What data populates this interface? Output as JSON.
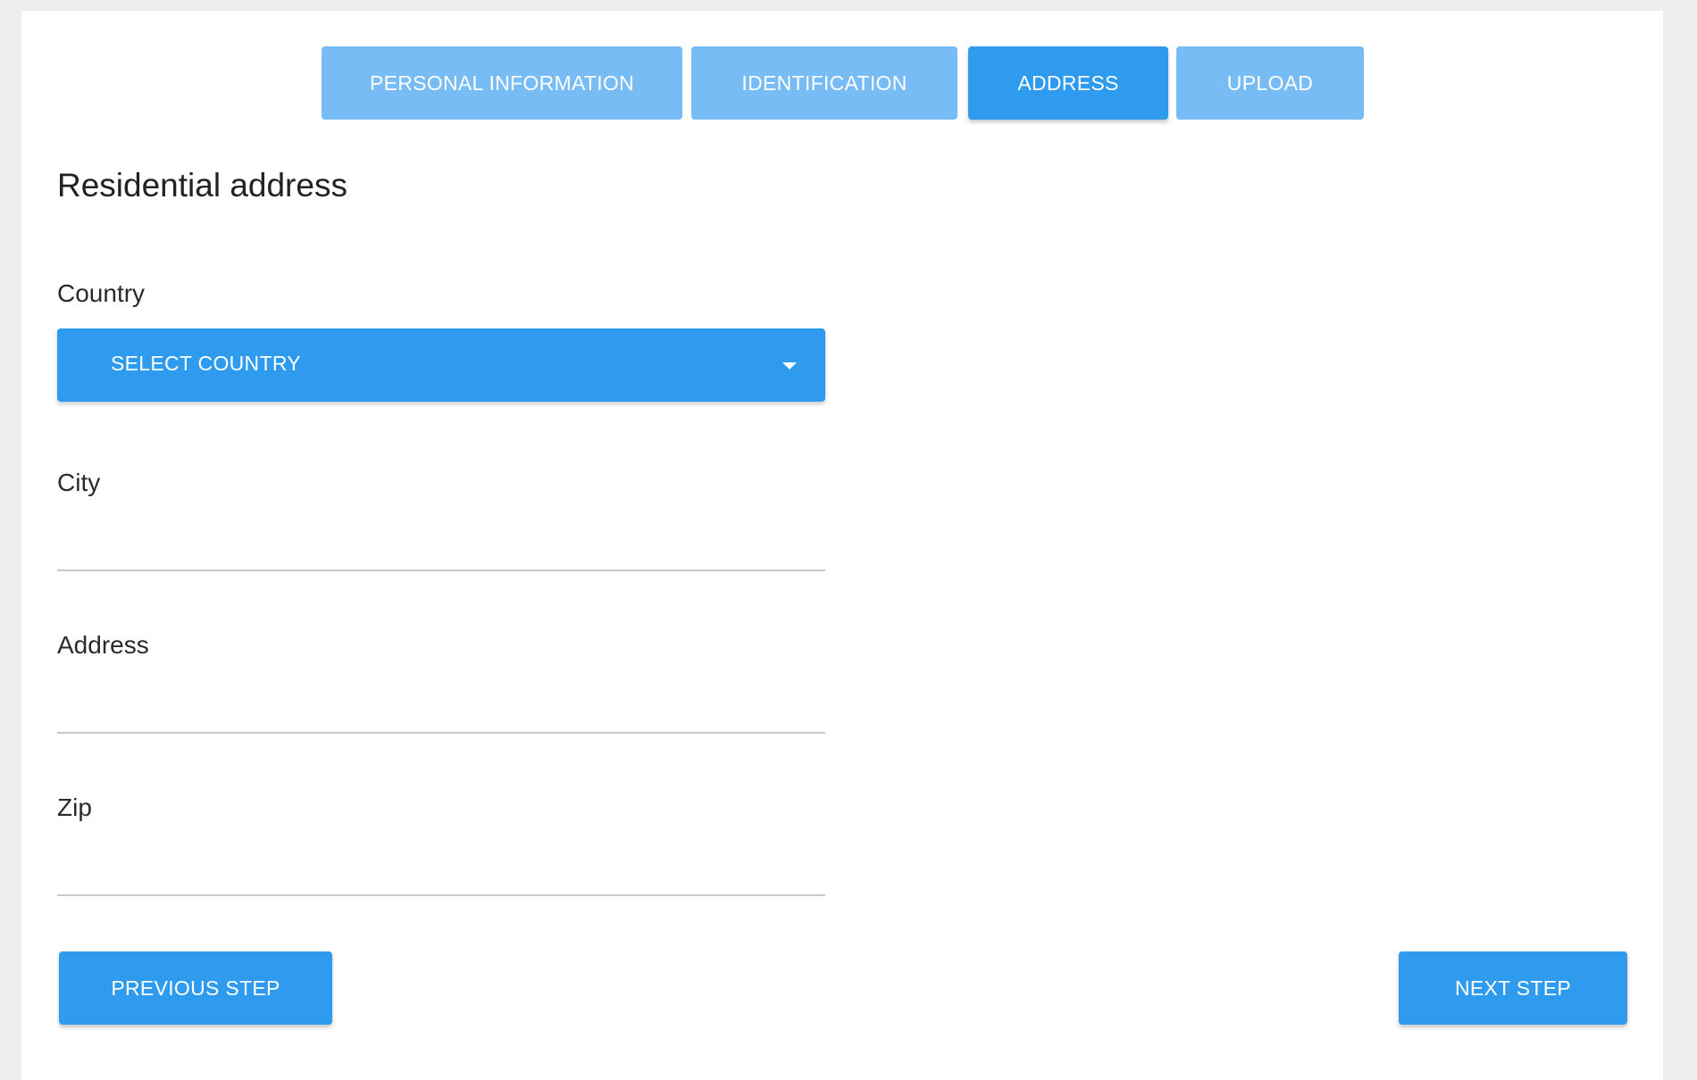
{
  "stepper": {
    "steps": [
      {
        "label": "PERSONAL INFORMATION",
        "active": false
      },
      {
        "label": "IDENTIFICATION",
        "active": false
      },
      {
        "label": "ADDRESS",
        "active": true
      },
      {
        "label": "UPLOAD",
        "active": false
      }
    ]
  },
  "form": {
    "title": "Residential address",
    "country": {
      "label": "Country",
      "selected": "SELECT COUNTRY"
    },
    "city": {
      "label": "City",
      "value": ""
    },
    "address": {
      "label": "Address",
      "value": ""
    },
    "zip": {
      "label": "Zip",
      "value": ""
    }
  },
  "actions": {
    "previous_label": "PREVIOUS STEP",
    "next_label": "NEXT STEP"
  },
  "colors": {
    "page_background": "#eeeeee",
    "primary": "#2f9bef",
    "primary_light": "#78bcf5",
    "input_underline": "#c8c8c8"
  }
}
